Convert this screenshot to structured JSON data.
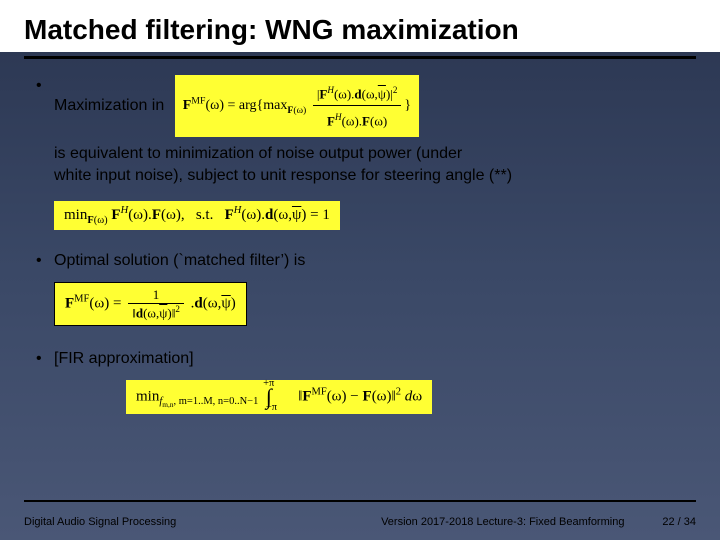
{
  "title": "Matched filtering: WNG maximization",
  "bullets": {
    "b1_lead": "Maximization in",
    "b1_eq": "𝐅ᴹᶠ(ω) = arg{ max₍𝐅(ω)₎ |𝐅ᴴ(ω).𝐝(ω,ψ̄)|² / (𝐅ᴴ(ω).𝐅(ω)) }",
    "b1_follow_l1": "is equivalent to minimization of noise output power (under",
    "b1_follow_l2": "white input noise), subject to unit response for steering angle (**)",
    "b1_constraint": "min₍𝐅(ω)₎ 𝐅ᴴ(ω).𝐅(ω),  s.t.  𝐅ᴴ(ω).𝐝(ω,ψ̄) = 1",
    "b2": "Optimal solution (`matched filter’) is",
    "b2_eq_lhs": "𝐅ᴹᶠ(ω) =",
    "b2_eq_num": "1",
    "b2_eq_den": "‖𝐝(ω,ψ̄)‖²",
    "b2_eq_rhs": ".𝐝(ω,ψ̄)",
    "b3": "[FIR approximation]",
    "b3_eq": "min₍f_{m,n}, m=1..M, n=0..N−1₎  ∫₋π⁺π ‖𝐅ᴹᶠ(ω) − 𝐅(ω)‖² dω"
  },
  "footer": {
    "left": "Digital Audio Signal Processing",
    "mid": "Version 2017-2018          Lecture-3: Fixed Beamforming",
    "page_cur": "22",
    "page_total": "34",
    "page_sep": " / "
  }
}
